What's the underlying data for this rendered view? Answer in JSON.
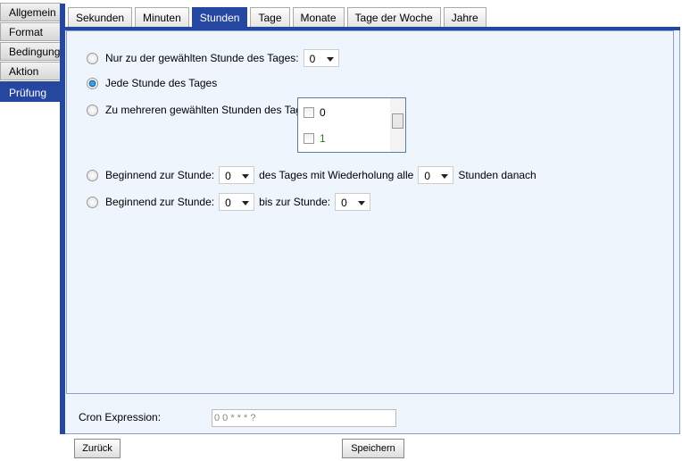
{
  "sidebar": {
    "items": [
      {
        "label": "Allgemein"
      },
      {
        "label": "Format"
      },
      {
        "label": "Bedingung"
      },
      {
        "label": "Aktion"
      },
      {
        "label": "Prüfung"
      }
    ]
  },
  "tabs": [
    {
      "label": "Sekunden"
    },
    {
      "label": "Minuten"
    },
    {
      "label": "Stunden"
    },
    {
      "label": "Tage"
    },
    {
      "label": "Monate"
    },
    {
      "label": "Tage der Woche"
    },
    {
      "label": "Jahre"
    }
  ],
  "options": {
    "specific_label": "Nur zu der gewählten Stunde des Tages:",
    "specific_value": "0",
    "every_label": "Jede Stunde des Tages",
    "multiple_label": "Zu mehreren gewählten Stunden des Tages",
    "multiple_items": [
      "0",
      "1"
    ],
    "repeat_label1": "Beginnend zur Stunde:",
    "repeat_start": "0",
    "repeat_label2": "des Tages mit Wiederholung alle",
    "repeat_interval": "0",
    "repeat_label3": "Stunden danach",
    "range_label1": "Beginnend zur Stunde:",
    "range_start": "0",
    "range_label2": "bis zur Stunde:",
    "range_end": "0"
  },
  "cron": {
    "label": "Cron Expression:",
    "value": "0 0 * * * ?"
  },
  "buttons": {
    "back": "Zurück",
    "save": "Speichern"
  }
}
